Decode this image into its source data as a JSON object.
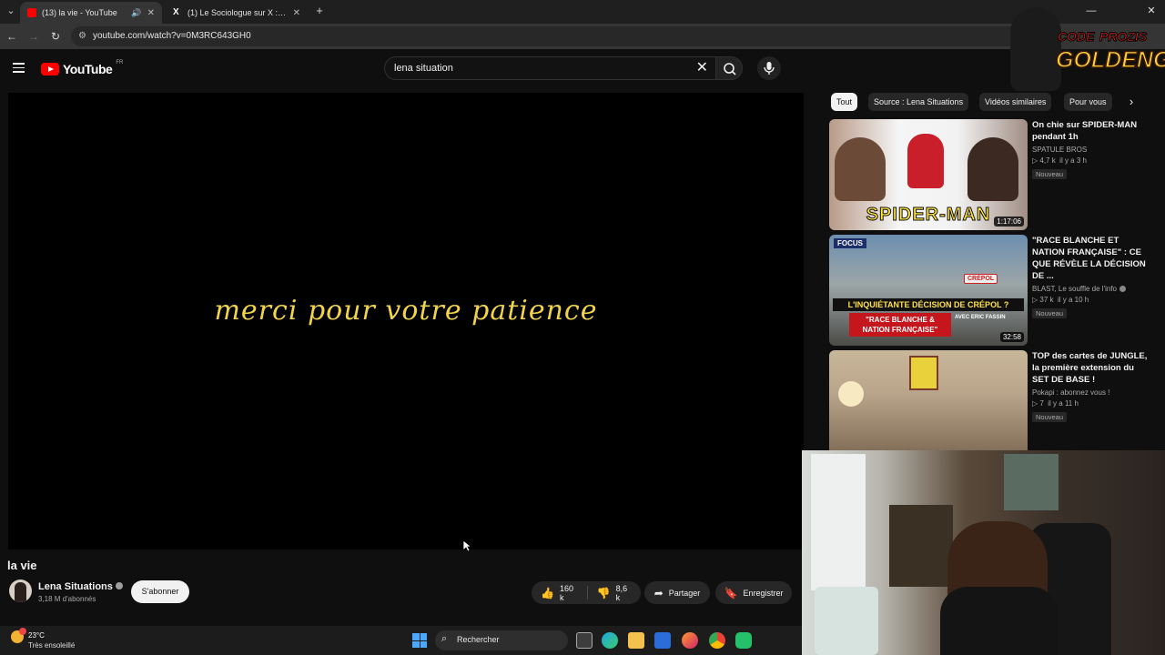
{
  "browser": {
    "tabs": [
      {
        "title": "(13) la vie - YouTube",
        "active": true
      },
      {
        "title": "(1) Le Sociologue sur X : \"Tu m",
        "active": false
      }
    ],
    "url": "youtube.com/watch?v=0M3RC643GH0"
  },
  "header": {
    "logo_text": "YouTube",
    "country_code": "FR",
    "search_query": "lena situation"
  },
  "player": {
    "overlay_text": "merci pour votre patience"
  },
  "video": {
    "title": "la vie",
    "channel": "Lena Situations",
    "subscribers": "3,18 M d'abonnés",
    "subscribe_label": "S'abonner",
    "likes": "160 k",
    "dislikes": "8,6 k",
    "share_label": "Partager",
    "save_label": "Enregistrer"
  },
  "sidebar": {
    "chips": [
      "Tout",
      "Source : Lena Situations",
      "Vidéos similaires",
      "Pour vous"
    ],
    "videos": [
      {
        "title": "On chie sur SPIDER-MAN pendant 1h",
        "channel": "SPATULE BROS",
        "views": "4,7 k",
        "age": "il y a 3 h",
        "badge": "Nouveau",
        "duration": "1:17:06",
        "thumb_text": "SPIDER-MAN"
      },
      {
        "title": "\"RACE BLANCHE ET NATION FRANÇAISE\" : CE QUE RÉVÈLE LA DÉCISION DE ...",
        "channel": "BLAST, Le souffle de l'info",
        "views": "37 k",
        "age": "il y a 10 h",
        "badge": "Nouveau",
        "duration": "32:58",
        "thumb_focus": "FOCUS",
        "thumb_banner": "L'INQUIÉTANTE DÉCISION DE CRÉPOL ?",
        "thumb_red": "\"RACE BLANCHE & NATION FRANÇAISE\"",
        "thumb_sub": "AVEC ERIC FASSIN",
        "thumb_sign": "CRÉPOL"
      },
      {
        "title": "TOP des cartes de JUNGLE, la première extension du SET DE BASE !",
        "channel": "Pokapi : abonnez vous !",
        "views": "7",
        "age": "il y a 11 h",
        "badge": "Nouveau"
      }
    ]
  },
  "overlay": {
    "logo_line1": "CODE",
    "logo_line1b": "PROZIS",
    "logo_line2": "GOLDENG"
  },
  "taskbar": {
    "temperature": "23°C",
    "condition": "Très ensoleillé",
    "search_label": "Rechercher"
  }
}
